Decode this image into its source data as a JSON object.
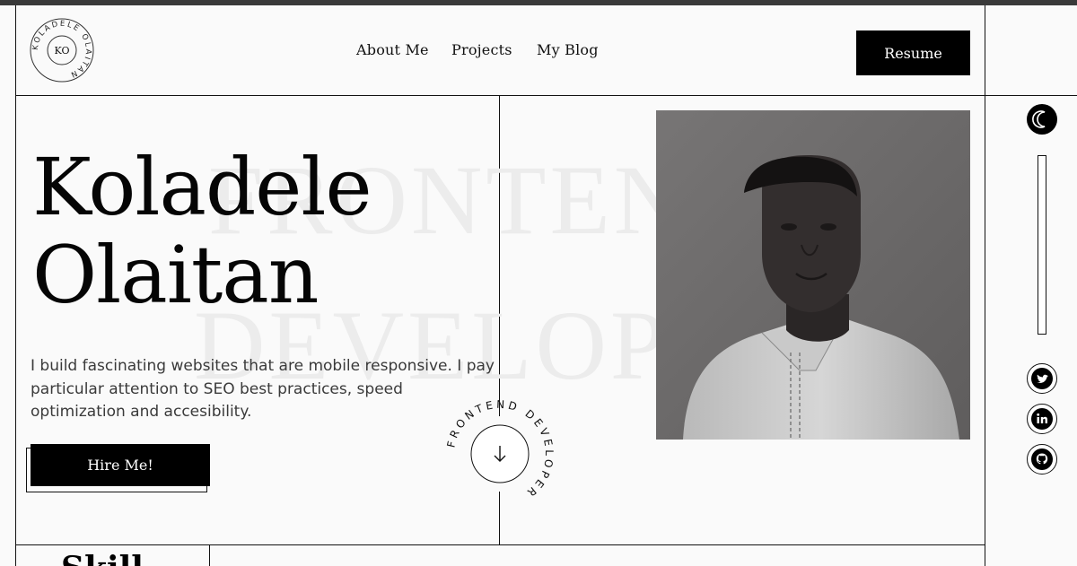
{
  "header": {
    "logo_text": "KO",
    "logo_ring_text": "KOLADELE OLAITAN",
    "nav": [
      {
        "label": "About Me"
      },
      {
        "label": "Projects"
      },
      {
        "label": "My Blog"
      }
    ],
    "resume_label": "Resume"
  },
  "hero": {
    "name_line1": "Koladele",
    "name_line2": "Olaitan",
    "watermark_line1": "FRONTEND",
    "watermark_line2": "DEVELOPER",
    "tagline": "I build fascinating websites that are mobile responsive. I pay particular attention to SEO best practices, speed optimization and accesibility.",
    "hire_label": "Hire Me!",
    "badge_text": "FRONTEND DEVELOPER",
    "badge_icon": "arrow-down-icon"
  },
  "sidebar": {
    "icons": [
      "moon-icon",
      "twitter-icon",
      "linkedin-icon",
      "github-icon"
    ]
  },
  "skills": {
    "heading_peek": "Skill"
  },
  "colors": {
    "background": "#fafafa",
    "ink": "#000000",
    "watermark": "#ececec",
    "text_muted": "#3a3a3a"
  }
}
